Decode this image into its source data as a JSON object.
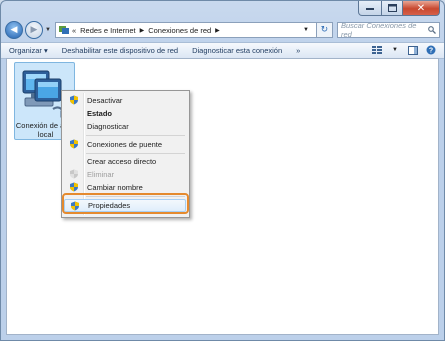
{
  "titlebar": {
    "minimize": "",
    "maximize": "",
    "close": "✕"
  },
  "address": {
    "breadcrumbs": [
      "Redes e Internet",
      "Conexiones de red"
    ],
    "overflow": "«",
    "search_placeholder": "Buscar Conexiones de red"
  },
  "toolbar": {
    "organize": "Organizar ▾",
    "disable_device": "Deshabilitar este dispositivo de red",
    "diagnose": "Diagnosticar esta conexión",
    "more": "»"
  },
  "item": {
    "label_line1": "Conexión de área",
    "label_line2": "local"
  },
  "menu": {
    "items": [
      {
        "label": "Desactivar",
        "shield": true
      },
      {
        "label": "Estado",
        "bold": true
      },
      {
        "label": "Diagnosticar"
      },
      {
        "label": "Conexiones de puente",
        "shield": true
      },
      {
        "label": "Crear acceso directo"
      },
      {
        "label": "Eliminar",
        "shield": true,
        "disabled": true
      },
      {
        "label": "Cambiar nombre",
        "shield": true
      },
      {
        "label": "Propiedades",
        "shield": true,
        "highlighted": true
      }
    ]
  },
  "colors": {
    "highlight_ring": "#e58a2e",
    "selection": "#cce6fa"
  }
}
